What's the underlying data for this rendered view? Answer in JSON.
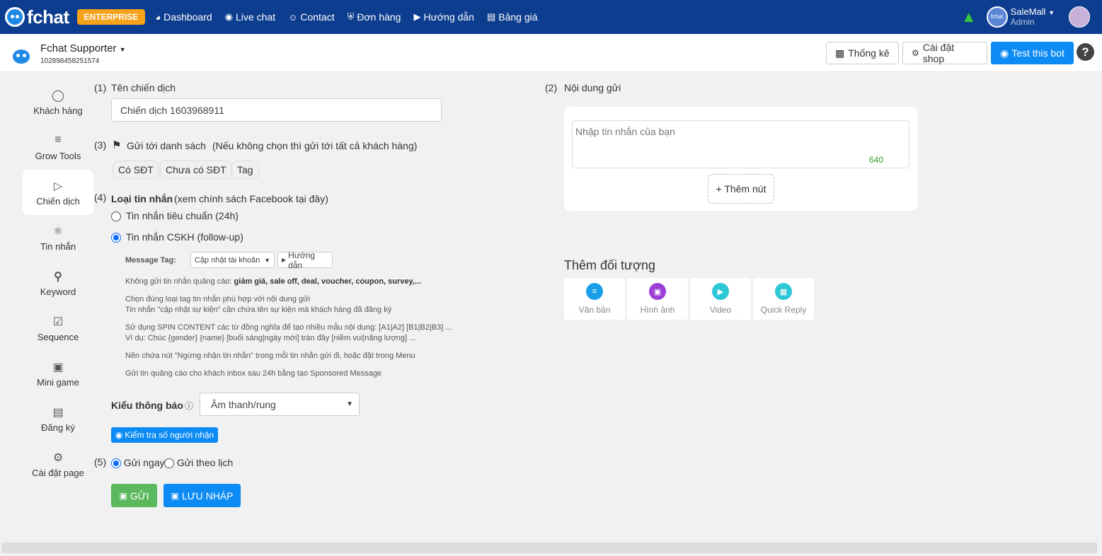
{
  "nav": {
    "brand": "fchat",
    "edition": "ENTERPRISE",
    "items": [
      {
        "icon": "dashboard-icon",
        "label": "Dashboard"
      },
      {
        "icon": "chat-icon",
        "label": "Live chat"
      },
      {
        "icon": "contact-icon",
        "label": "Contact"
      },
      {
        "icon": "cart-icon",
        "label": "Đơn hàng"
      },
      {
        "icon": "play-icon",
        "label": "Hướng dẫn"
      },
      {
        "icon": "price-icon",
        "label": "Bảng giá"
      }
    ],
    "account_name": "SaleMall",
    "account_role": "Admin",
    "account_avatar_text": "fchat"
  },
  "header": {
    "page_name": "Fchat Supporter",
    "page_id": "102898458251574",
    "stats_label": "Thống kê",
    "shop_settings_label": "Cài đặt shop",
    "test_bot_label": "Test this bot",
    "help_label": "?"
  },
  "sidebar": {
    "items": [
      {
        "icon": "user-icon",
        "label": "Khách hàng"
      },
      {
        "icon": "grow-tools-icon",
        "label": "Grow Tools"
      },
      {
        "icon": "send-icon",
        "label": "Chiến dịch"
      },
      {
        "icon": "atom-icon",
        "label": "Tin nhắn"
      },
      {
        "icon": "key-icon",
        "label": "Keyword"
      },
      {
        "icon": "calendar-check-icon",
        "label": "Sequence"
      },
      {
        "icon": "gamepad-icon",
        "label": "Mini game"
      },
      {
        "icon": "form-icon",
        "label": "Đăng ký"
      },
      {
        "icon": "gear-icon",
        "label": "Cài đặt page"
      }
    ],
    "active": "Chiến dịch"
  },
  "campaign": {
    "step1": "(1)",
    "name_label": "Tên chiến dịch",
    "name_value": "Chiến dịch 1603968911",
    "step3": "(3)",
    "send_to_label": "Gửi tới danh sách",
    "send_to_hint": "(Nếu không chọn thì gửi tới tất cả khách hàng)",
    "chips": [
      "Có SĐT",
      "Chưa có SĐT",
      "Tag"
    ],
    "step4": "(4)",
    "msg_type_label": "Loại tin nhắn",
    "msg_type_hint": "(xem chính sách Facebook tại đây)",
    "radio_standard": "Tin nhắn tiêu chuẩn (24h)",
    "radio_followup": "Tin nhắn CSKH (follow-up)",
    "message_tag_label": "Message Tag:",
    "message_tag_value": "Cập nhật tài khoản",
    "guide_button": "Hướng dẫn",
    "note1_prefix": "Không gửi tin nhắn quảng cáo: ",
    "note1_bold": "giảm giá, sale off, deal, voucher, coupon, survey,...",
    "note2a": "Chọn đúng loại tag tin nhắn phù hợp với nội dung gửi",
    "note2b": "Tin nhắn \"cập nhật sự kiện\" cần chứa tên sự kiện mà khách hàng đã đăng ký",
    "note3a": "Sử dụng SPIN CONTENT các từ đồng nghĩa để tạo nhiều mẫu nội dung: [A1|A2] [B1|B2|B3] ...",
    "note3b": "Ví dụ: Chúc {gender} {name} [buổi sáng|ngày mới] tràn đầy [niềm vui|năng lượng] ...",
    "note4": "Nên chứa nút \"Ngừng nhận tin nhắn\" trong mỗi tin nhắn gửi đi, hoặc đặt trong Menu",
    "note5": "Gửi tin quảng cáo cho khách inbox sau 24h bằng tạo Sponsored Message",
    "notify_label": "Kiểu thông báo",
    "notify_value": "Âm thanh/rung",
    "check_recipients": "Kiểm tra số người nhận",
    "step5": "(5)",
    "send_now": "Gửi ngay",
    "send_schedule": "Gửi theo lịch",
    "send_button": "GỬI",
    "draft_button": "LƯU NHÁP"
  },
  "content": {
    "step2": "(2)",
    "label": "Nội dung gửi",
    "placeholder": "Nhập tin nhắn của bạn",
    "char_count": "640",
    "add_button": "+ Thêm nút",
    "add_object_title": "Thêm đối tượng",
    "objects": [
      {
        "icon": "text-icon",
        "label": "Văn bản",
        "color": "#1aa0e8"
      },
      {
        "icon": "image-icon",
        "label": "Hình ảnh",
        "color": "#9b3fd6"
      },
      {
        "icon": "video-icon",
        "label": "Video",
        "color": "#2ec7d6"
      },
      {
        "icon": "quick-reply-icon",
        "label": "Quick Reply",
        "color": "#2ec7d6"
      }
    ]
  },
  "colors": {
    "navbar": "#0d3d8f",
    "primary": "#0d8bf5",
    "success": "#5cb85c",
    "step_marker": "#e02020"
  }
}
